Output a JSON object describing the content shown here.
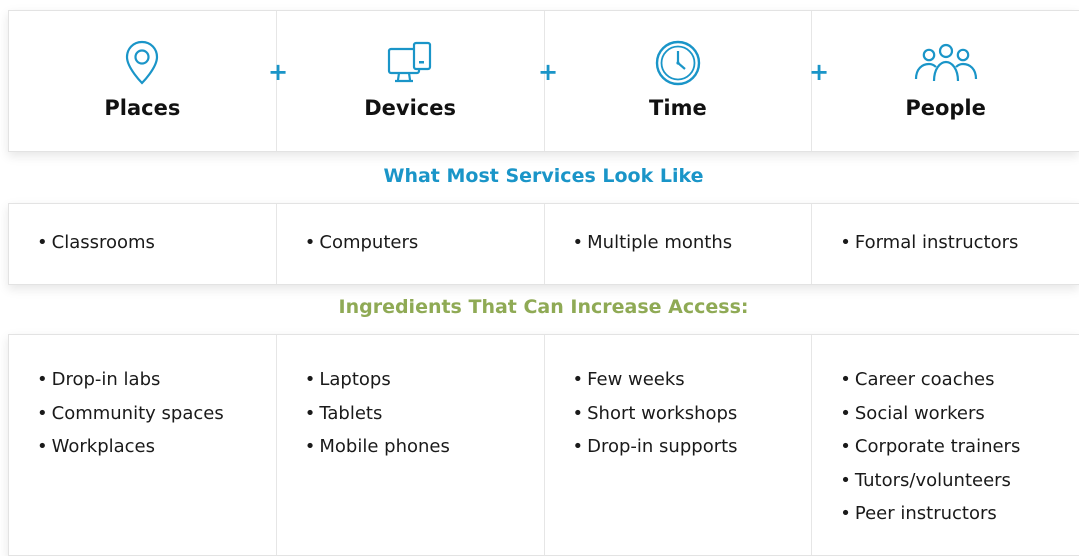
{
  "categories": [
    {
      "label": "Places",
      "icon": "map-pin-icon"
    },
    {
      "label": "Devices",
      "icon": "devices-icon"
    },
    {
      "label": "Time",
      "icon": "clock-icon"
    },
    {
      "label": "People",
      "icon": "people-icon"
    }
  ],
  "operator": "+",
  "bullet": "•",
  "colors": {
    "accent_blue": "#1a95c8",
    "accent_green": "#8faa55"
  },
  "section_most": {
    "title": "What Most Services Look Like",
    "items": [
      "Classrooms",
      "Computers",
      "Multiple months",
      "Formal instructors"
    ]
  },
  "section_ingredients": {
    "title": "Ingredients That Can Increase Access:",
    "columns": [
      [
        "Drop-in labs",
        "Community spaces",
        "Workplaces"
      ],
      [
        "Laptops",
        "Tablets",
        "Mobile phones"
      ],
      [
        "Few weeks",
        "Short workshops",
        "Drop-in supports"
      ],
      [
        "Career coaches",
        "Social workers",
        "Corporate trainers",
        "Tutors/volunteers",
        "Peer instructors"
      ]
    ]
  }
}
